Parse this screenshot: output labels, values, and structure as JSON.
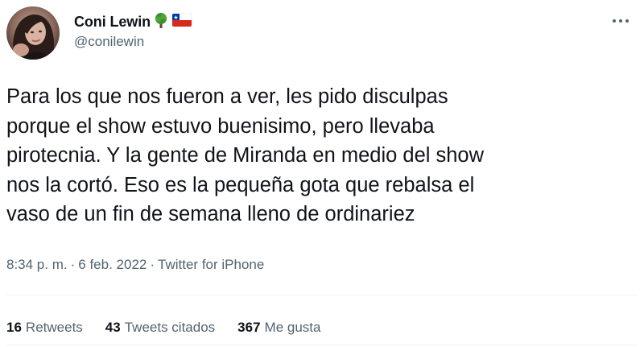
{
  "user": {
    "display_name": "Coni Lewin",
    "handle": "@conilewin",
    "badges": [
      "tree-emoji",
      "chile-flag-emoji"
    ]
  },
  "tweet": {
    "text": "Para los que nos fueron a ver, les pido disculpas\nporque el show estuvo buenisimo, pero llevaba\npirotecnia. Y la gente de Miranda en medio del show\nnos la cortó. Eso es la pequeña gota que rebalsa el\nvaso de un fin de semana lleno de ordinariez",
    "time": "8:34 p. m.",
    "separator": "·",
    "date": "6 feb. 2022",
    "source": "Twitter for iPhone"
  },
  "stats": [
    {
      "count": "16",
      "label": "Retweets"
    },
    {
      "count": "43",
      "label": "Tweets citados"
    },
    {
      "count": "367",
      "label": "Me gusta"
    }
  ],
  "colors": {
    "primary_text": "#0f1419",
    "secondary_text": "#536471",
    "divider": "#eff3f4"
  },
  "icons": {
    "more": "more-horizontal-icon"
  }
}
